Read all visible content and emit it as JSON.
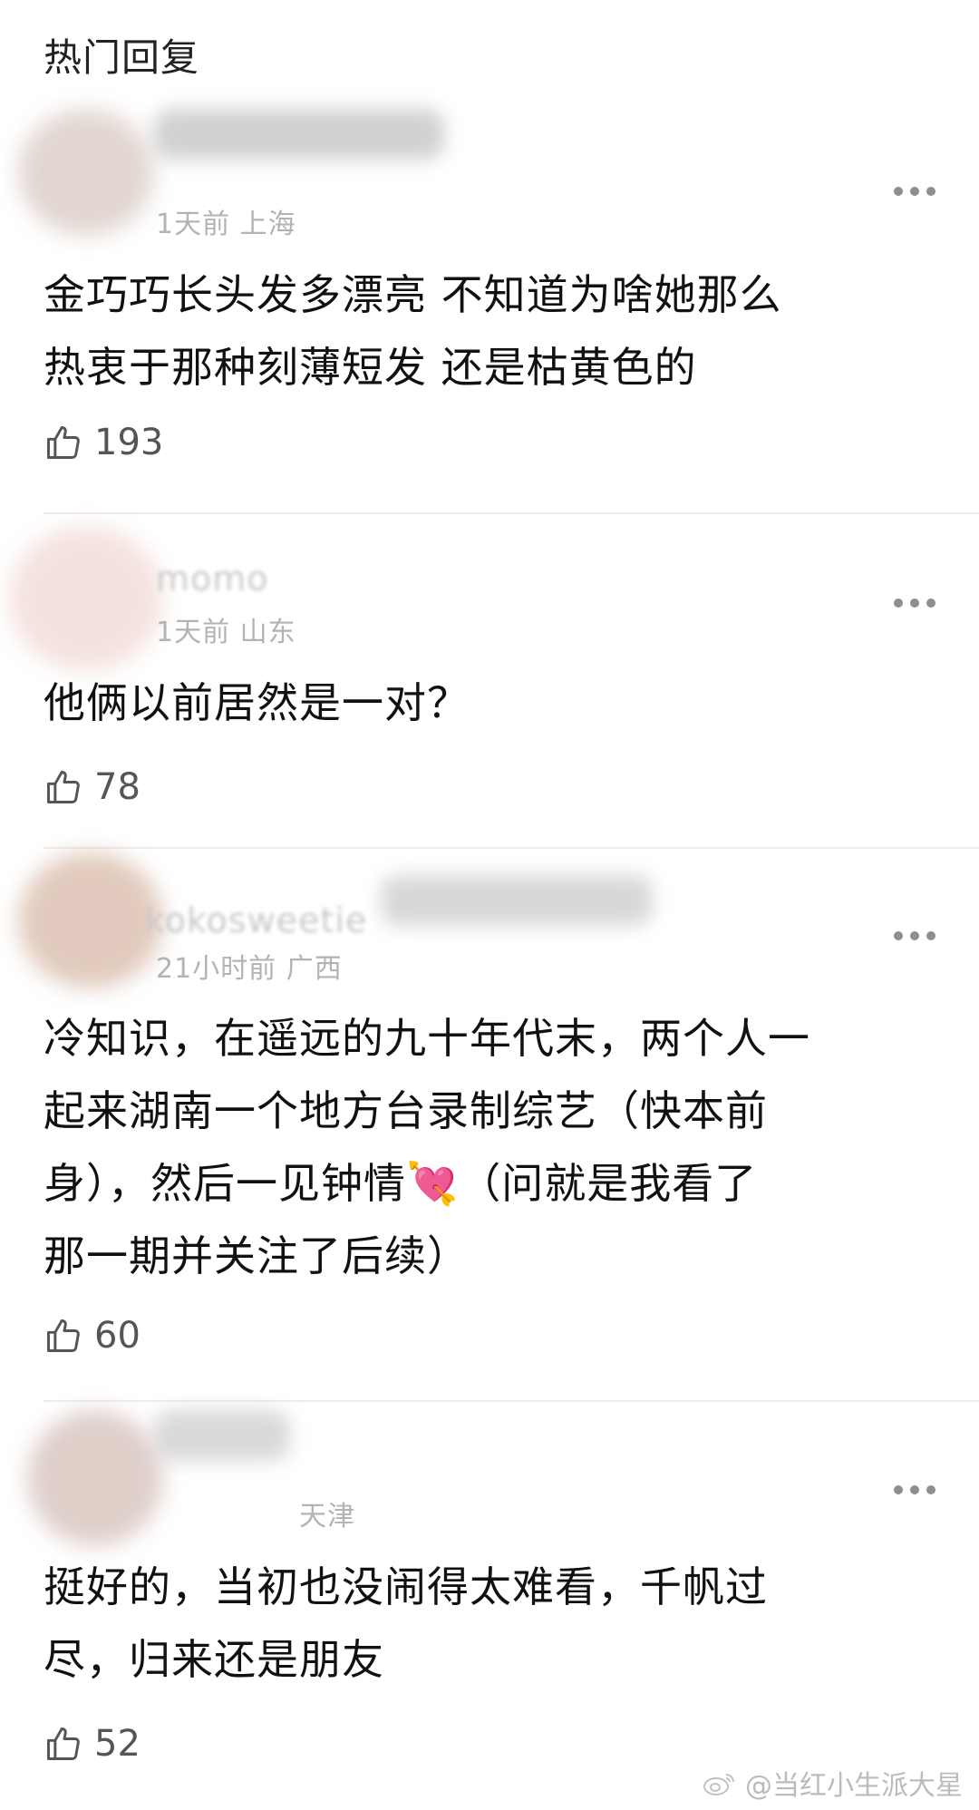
{
  "header": {
    "title": "热门回复"
  },
  "comments": [
    {
      "meta": "1天前 上海",
      "text": "金巧巧长头发多漂亮 不知道为啥她那么\n热衷于那种刻薄短发 还是枯黄色的",
      "likes": "193"
    },
    {
      "username": "momo",
      "meta": "1天前 山东",
      "text": "他俩以前居然是一对？",
      "likes": "78"
    },
    {
      "username": "kokosweetie",
      "meta": "21小时前 广西",
      "text": "冷知识，在遥远的九十年代末，两个人一\n起来湖南一个地方台录制综艺（快本前\n身），然后一见钟情💘（问就是我看了\n那一期并关注了后续）",
      "likes": "60"
    },
    {
      "meta": "天津",
      "text": "挺好的，当初也没闹得太难看，千帆过\n尽，归来还是朋友",
      "likes": "52"
    }
  ],
  "watermark": {
    "text": "@当红小生派大星"
  },
  "icons": {
    "more": "more-dots-icon",
    "like": "thumbs-up-icon",
    "weibo": "weibo-logo-icon"
  }
}
